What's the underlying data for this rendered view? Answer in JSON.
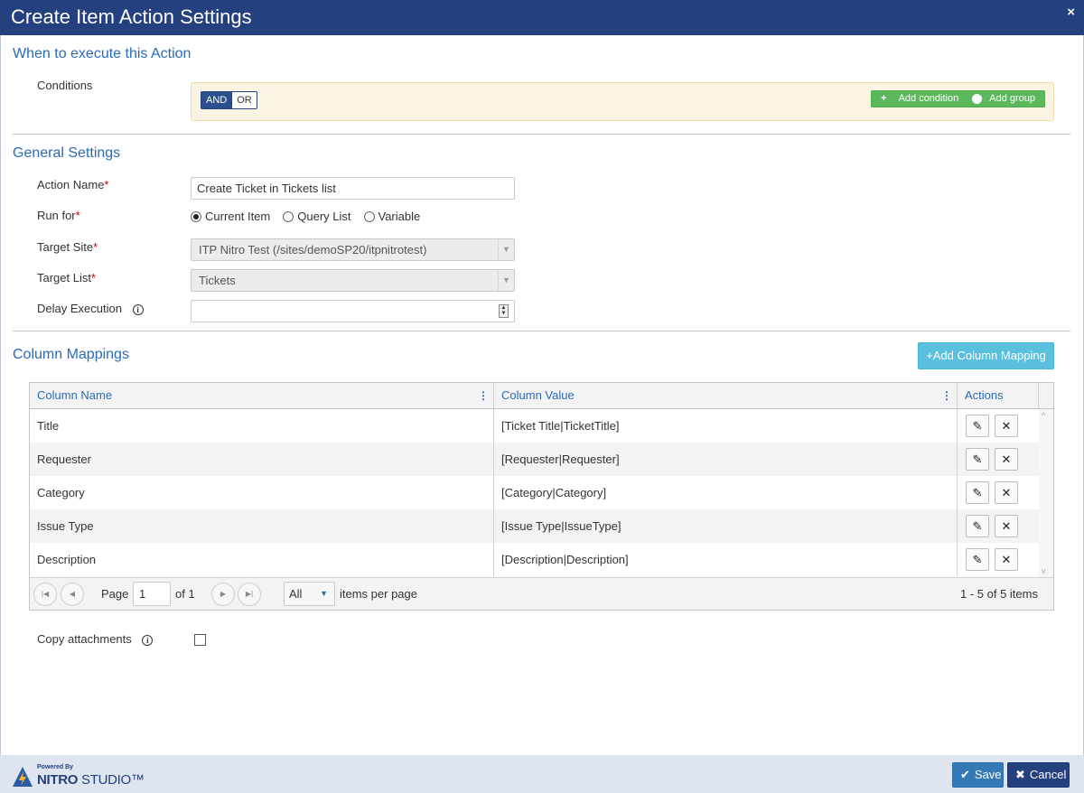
{
  "dialog": {
    "title": "Create Item Action Settings",
    "close_glyph": "×"
  },
  "when": {
    "section_title": "When to execute this Action",
    "conditions_label": "Conditions",
    "and_label": "AND",
    "or_label": "OR",
    "add_condition_label": "Add condition",
    "add_group_label": "Add group"
  },
  "general": {
    "section_title": "General Settings",
    "action_name_label": "Action Name",
    "action_name_value": "Create Ticket in Tickets list",
    "run_for_label": "Run for",
    "run_for_options": [
      "Current Item",
      "Query List",
      "Variable"
    ],
    "run_for_selected": "Current Item",
    "target_site_label": "Target Site",
    "target_site_value": "ITP Nitro Test (/sites/demoSP20/itpnitrotest)",
    "target_list_label": "Target List",
    "target_list_value": "Tickets",
    "delay_label": "Delay Execution",
    "delay_value": "",
    "required_mark": "*"
  },
  "mappings": {
    "section_title": "Column Mappings",
    "add_button_label": "Add Column Mapping",
    "columns": [
      "Column Name",
      "Column Value",
      "Actions"
    ],
    "rows": [
      {
        "name": "Title",
        "value": "[Ticket Title|TicketTitle]"
      },
      {
        "name": "Requester",
        "value": "[Requester|Requester]"
      },
      {
        "name": "Category",
        "value": "[Category|Category]"
      },
      {
        "name": "Issue Type",
        "value": "[Issue Type|IssueType]"
      },
      {
        "name": "Description",
        "value": "[Description|Description]"
      }
    ],
    "pager": {
      "page_label": "Page",
      "page_value": "1",
      "of_label": "of 1",
      "per_page_value": "All",
      "per_page_label": "items per page",
      "summary": "1 - 5 of 5 items"
    }
  },
  "copy_attachments": {
    "label": "Copy attachments",
    "checked": false
  },
  "footer": {
    "powered_by": "Powered By",
    "brand_bold": "NITRO",
    "brand_rest": "STUDIO™",
    "save_label": "Save",
    "cancel_label": "Cancel"
  },
  "icons": {
    "info": "info-icon",
    "edit": "pencil-icon",
    "delete": "x-icon",
    "save": "check-icon",
    "cancel": "x-icon",
    "add": "plus-icon"
  },
  "colors": {
    "header": "#25407f",
    "accent_text": "#2a6ab8",
    "success": "#5cb85c",
    "info": "#5bc0de",
    "primary": "#337ab7"
  }
}
